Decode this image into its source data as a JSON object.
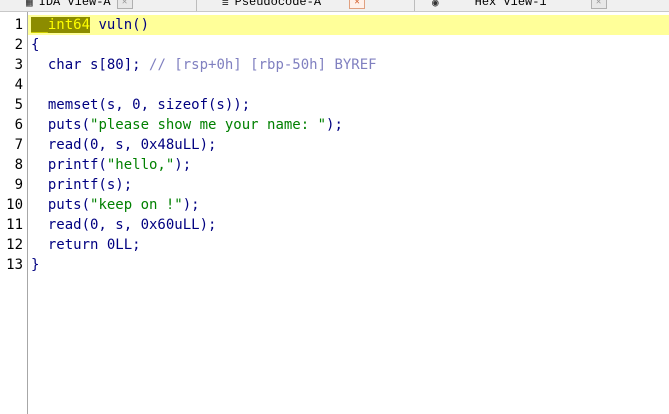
{
  "tabs": [
    {
      "label": "IDA View-A",
      "icon": "▦",
      "active": false
    },
    {
      "label": "Pseudocode-A",
      "icon": "≡",
      "active": true
    },
    {
      "label": "Hex View-1",
      "icon": "◉",
      "active": false
    }
  ],
  "line_numbers": [
    "1",
    "2",
    "3",
    "4",
    "5",
    "6",
    "7",
    "8",
    "9",
    "10",
    "11",
    "12",
    "13"
  ],
  "code": {
    "l1_type": "__int64",
    "l1_rest": " vuln()",
    "l2": "{",
    "l3_decl": "  char s[80]; ",
    "l3_comment": "// [rsp+0h] [rbp-50h] BYREF",
    "l5": "  memset(s, 0, sizeof(s));",
    "l6_a": "  puts(",
    "l6_str": "\"please show me your name: \"",
    "l6_b": ");",
    "l7": "  read(0, s, 0x48uLL);",
    "l8_a": "  printf(",
    "l8_str": "\"hello,\"",
    "l8_b": ");",
    "l9": "  printf(s);",
    "l10_a": "  puts(",
    "l10_str": "\"keep on !\"",
    "l10_b": ");",
    "l11": "  read(0, s, 0x60uLL);",
    "l12": "  return 0LL;",
    "l13": "}"
  }
}
